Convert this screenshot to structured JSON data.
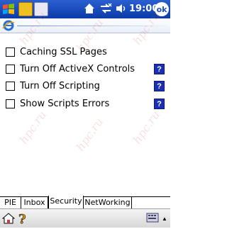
{
  "statusbar": {
    "time": "19:00",
    "ok_label": "ok",
    "icons": [
      "windows-start-icon",
      "app1-icon",
      "app2-icon",
      "home-icon",
      "connectivity-icon",
      "volume-icon"
    ]
  },
  "options": [
    {
      "label": "Caching SSL Pages",
      "checked": false,
      "has_help": false
    },
    {
      "label": "Turn Off ActiveX Controls",
      "checked": false,
      "has_help": true
    },
    {
      "label": "Turn Off Scripting",
      "checked": false,
      "has_help": true
    },
    {
      "label": "Show Scripts Errors",
      "checked": false,
      "has_help": true
    }
  ],
  "help_label": "?",
  "tabs": [
    {
      "label": "PIE",
      "active": false
    },
    {
      "label": "Inbox",
      "active": false
    },
    {
      "label": "Security",
      "active": true
    },
    {
      "label": "NetWorking",
      "active": false
    }
  ],
  "watermark": "hpc.ru",
  "colors": {
    "taskbar": "#1a4fc0",
    "help": "#1b2fb3"
  }
}
